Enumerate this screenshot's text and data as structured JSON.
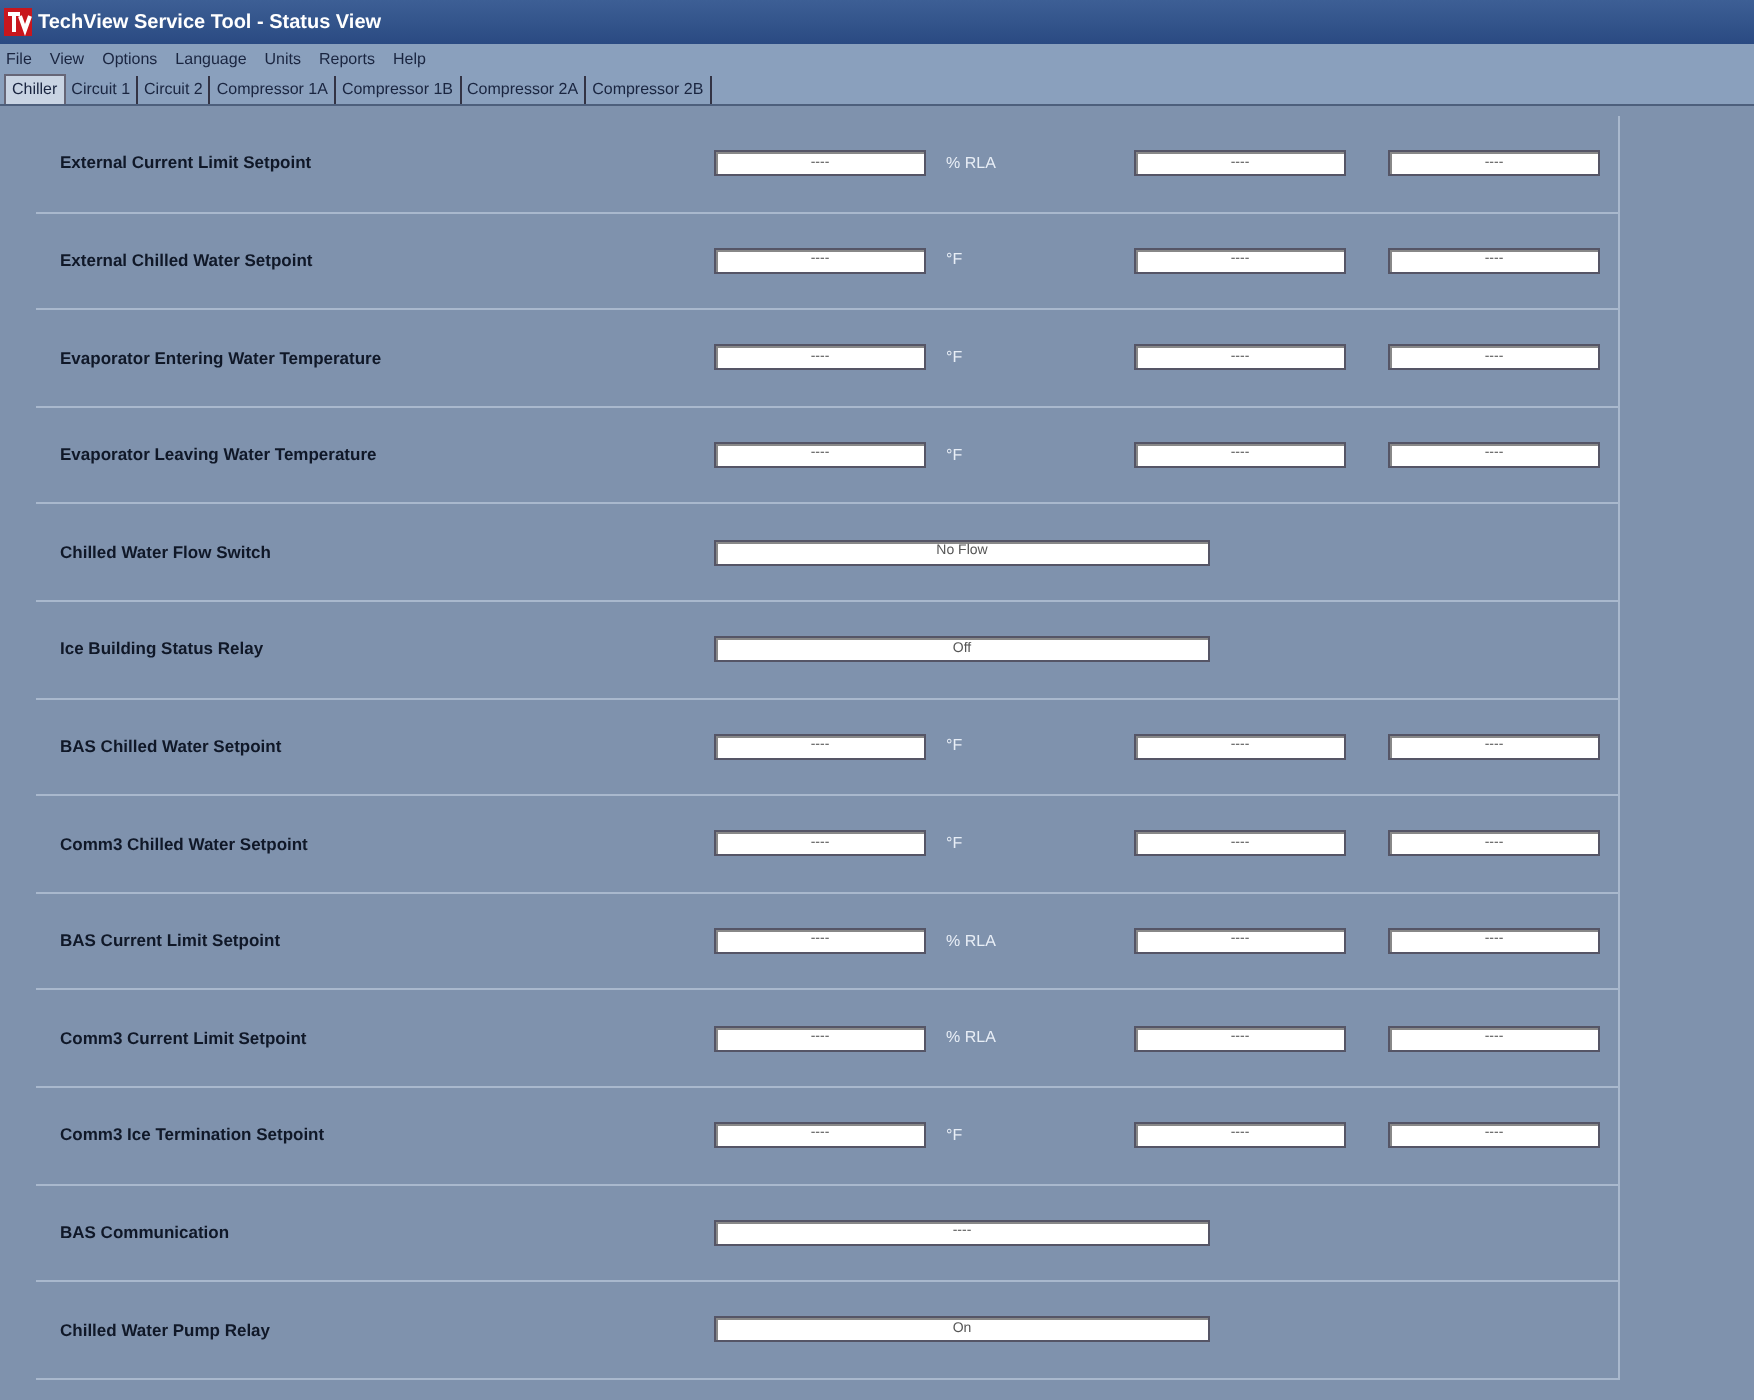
{
  "window": {
    "title": "TechView Service Tool - Status View"
  },
  "menu": [
    "File",
    "View",
    "Options",
    "Language",
    "Units",
    "Reports",
    "Help"
  ],
  "tabs": [
    {
      "label": "Chiller",
      "selected": true
    },
    {
      "label": "Circuit 1",
      "selected": false
    },
    {
      "label": "Circuit 2",
      "selected": false
    },
    {
      "label": "Compressor 1A",
      "selected": false
    },
    {
      "label": "Compressor 1B",
      "selected": false
    },
    {
      "label": "Compressor 2A",
      "selected": false
    },
    {
      "label": "Compressor 2B",
      "selected": false
    }
  ],
  "rows": [
    {
      "kind": "triple",
      "label": "External Current Limit Setpoint",
      "values": [
        "----",
        "----",
        "----"
      ],
      "unit": "% RLA"
    },
    {
      "kind": "triple",
      "label": "External Chilled Water Setpoint",
      "values": [
        "----",
        "----",
        "----"
      ],
      "unit": "°F"
    },
    {
      "kind": "triple",
      "label": "Evaporator Entering Water Temperature",
      "values": [
        "----",
        "----",
        "----"
      ],
      "unit": "°F"
    },
    {
      "kind": "triple",
      "label": "Evaporator Leaving Water Temperature",
      "values": [
        "----",
        "----",
        "----"
      ],
      "unit": "°F"
    },
    {
      "kind": "single",
      "label": "Chilled Water Flow Switch",
      "value": "No Flow"
    },
    {
      "kind": "single",
      "label": "Ice Building Status Relay",
      "value": "Off"
    },
    {
      "kind": "triple",
      "label": "BAS Chilled Water Setpoint",
      "values": [
        "----",
        "----",
        "----"
      ],
      "unit": "°F"
    },
    {
      "kind": "triple",
      "label": "Comm3 Chilled Water Setpoint",
      "values": [
        "----",
        "----",
        "----"
      ],
      "unit": "°F"
    },
    {
      "kind": "triple",
      "label": "BAS Current Limit Setpoint",
      "values": [
        "----",
        "----",
        "----"
      ],
      "unit": "% RLA"
    },
    {
      "kind": "triple",
      "label": "Comm3 Current Limit Setpoint",
      "values": [
        "----",
        "----",
        "----"
      ],
      "unit": "% RLA"
    },
    {
      "kind": "triple",
      "label": "Comm3 Ice Termination Setpoint",
      "values": [
        "----",
        "----",
        "----"
      ],
      "unit": "°F"
    },
    {
      "kind": "single",
      "label": "BAS Communication",
      "value": "----"
    },
    {
      "kind": "single",
      "label": "Chilled Water Pump Relay",
      "value": "On"
    }
  ]
}
